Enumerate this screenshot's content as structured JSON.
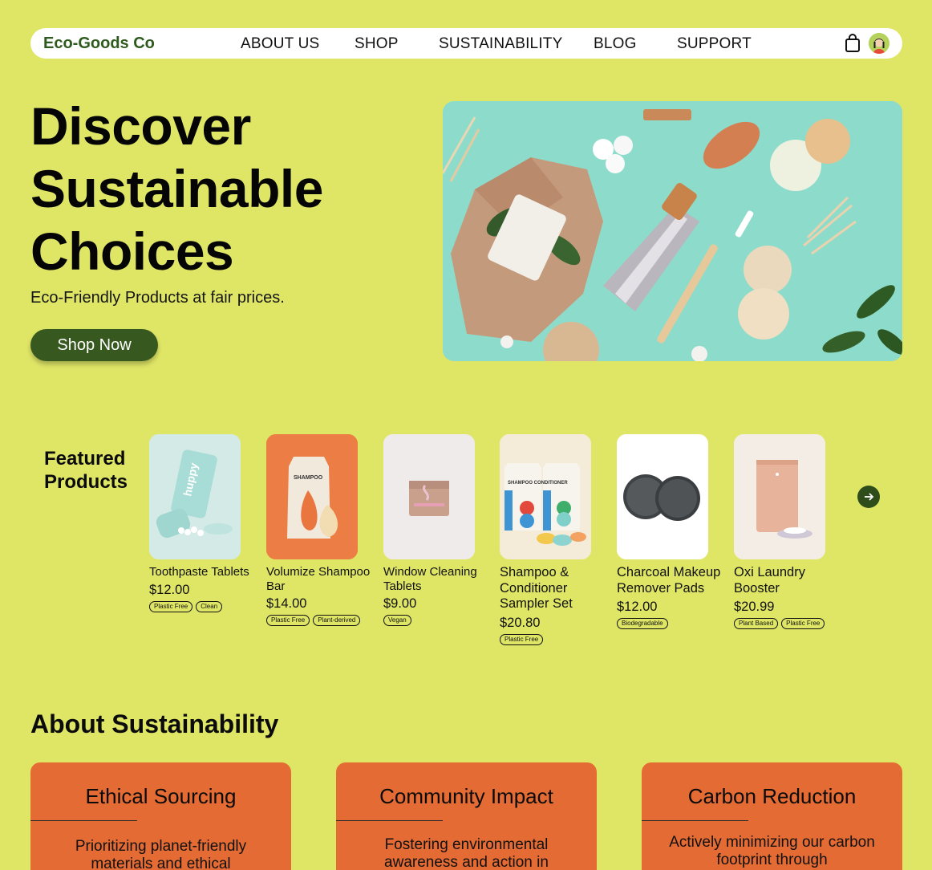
{
  "nav": {
    "brand": "Eco-Goods Co",
    "links": [
      "ABOUT US",
      "SHOP",
      "SUSTAINABILITY",
      "BLOG",
      "SUPPORT"
    ],
    "cart_icon": "shopping-bag-icon",
    "avatar_icon": "user-avatar-icon"
  },
  "hero": {
    "title_lines": [
      "Discover",
      "Sustainable",
      "Choices"
    ],
    "subtitle": "Eco-Friendly Products at fair prices.",
    "cta": "Shop Now"
  },
  "featured": {
    "title_lines": [
      "Featured",
      "Products"
    ],
    "next_icon": "arrow-right-icon",
    "products": [
      {
        "name": "Toothpaste Tablets",
        "price": "$12.00",
        "tags": [
          "Plastic Free",
          "Clean"
        ],
        "image_label": "huppy",
        "bg": "#cfe8e4"
      },
      {
        "name": "Volumize Shampoo Bar",
        "price": "$14.00",
        "tags": [
          "Plastic Free",
          "Plant-derived"
        ],
        "image_label": "SHAMPOO",
        "bg": "#ec7d45"
      },
      {
        "name": "Window Cleaning Tablets",
        "price": "$9.00",
        "tags": [
          "Vegan"
        ],
        "image_label": "",
        "bg": "#eeeaea"
      },
      {
        "name": "Shampoo & Conditioner Sampler Set",
        "price": "$20.80",
        "tags": [
          "Plastic Free"
        ],
        "image_label": "SHAMPOO CONDITIONER",
        "bg": "#f3ead6"
      },
      {
        "name": "Charcoal Makeup Remover Pads",
        "price": "$12.00",
        "tags": [
          "Biodegradable"
        ],
        "image_label": "",
        "bg": "#ffffff"
      },
      {
        "name": "Oxi Laundry Booster",
        "price": "$20.99",
        "tags": [
          "Plant Based",
          "Plastic Free"
        ],
        "image_label": "",
        "bg": "#f3ece5"
      }
    ]
  },
  "about": {
    "title": "About Sustainability",
    "cards": [
      {
        "title": "Ethical Sourcing",
        "text": "Prioritizing planet-friendly materials and ethical"
      },
      {
        "title": "Community Impact",
        "text": "Fostering environmental awareness and action in"
      },
      {
        "title": "Carbon Reduction",
        "text": "Actively minimizing our carbon footprint through"
      }
    ]
  },
  "colors": {
    "background": "#dfe666",
    "accent_dark_green": "#37591f",
    "card_orange": "#e46b33"
  }
}
